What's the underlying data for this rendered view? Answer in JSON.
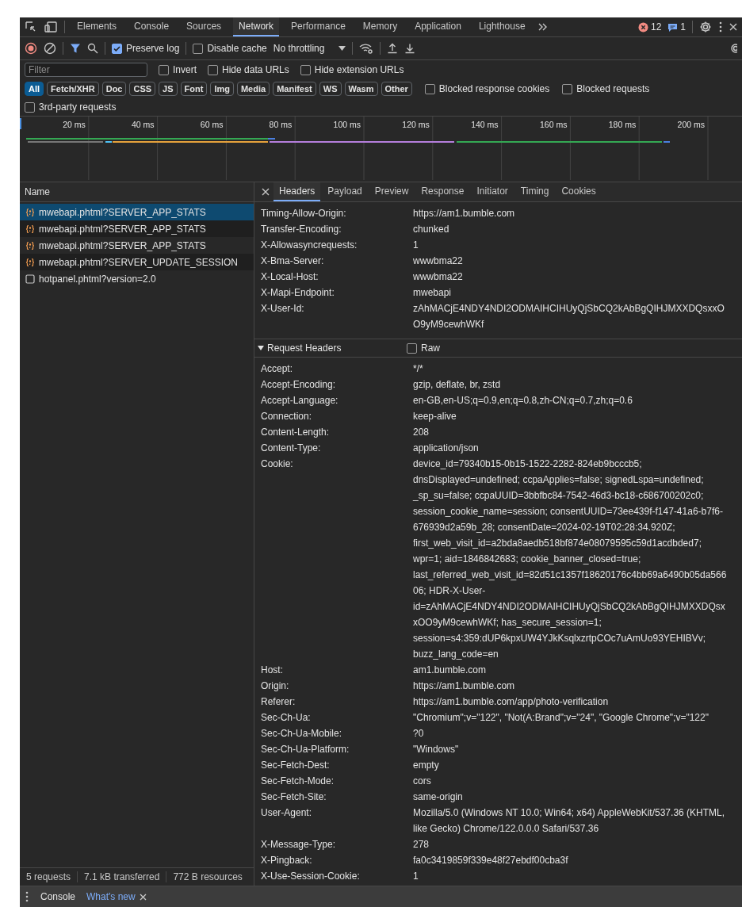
{
  "tabs": [
    {
      "label": "Elements",
      "selected": false
    },
    {
      "label": "Console",
      "selected": false
    },
    {
      "label": "Sources",
      "selected": false
    },
    {
      "label": "Network",
      "selected": true
    },
    {
      "label": "Performance",
      "selected": false
    },
    {
      "label": "Memory",
      "selected": false
    },
    {
      "label": "Application",
      "selected": false
    },
    {
      "label": "Lighthouse",
      "selected": false
    }
  ],
  "issues": {
    "errors": "12",
    "messages": "1"
  },
  "toolbar": {
    "preserve_log": {
      "label": "Preserve log",
      "checked": true
    },
    "disable_cache": {
      "label": "Disable cache",
      "checked": false
    },
    "throttling": "No throttling"
  },
  "filter": {
    "placeholder": "Filter",
    "options": [
      {
        "label": "Invert",
        "checked": false
      },
      {
        "label": "Hide data URLs",
        "checked": false
      },
      {
        "label": "Hide extension URLs",
        "checked": false
      }
    ]
  },
  "type_filters": [
    {
      "label": "All",
      "selected": true
    },
    {
      "label": "Fetch/XHR",
      "selected": false
    },
    {
      "label": "Doc",
      "selected": false
    },
    {
      "label": "CSS",
      "selected": false
    },
    {
      "label": "JS",
      "selected": false
    },
    {
      "label": "Font",
      "selected": false
    },
    {
      "label": "Img",
      "selected": false
    },
    {
      "label": "Media",
      "selected": false
    },
    {
      "label": "Manifest",
      "selected": false
    },
    {
      "label": "WS",
      "selected": false
    },
    {
      "label": "Wasm",
      "selected": false
    },
    {
      "label": "Other",
      "selected": false
    }
  ],
  "extra_filters": [
    {
      "label": "Blocked response cookies",
      "checked": false
    },
    {
      "label": "Blocked requests",
      "checked": false
    }
  ],
  "third_party": {
    "label": "3rd-party requests",
    "checked": false
  },
  "timeline": {
    "ticks": [
      "20 ms",
      "40 ms",
      "60 ms",
      "80 ms",
      "100 ms",
      "120 ms",
      "140 ms",
      "160 ms",
      "180 ms",
      "200 ms"
    ]
  },
  "requests": {
    "column": "Name",
    "rows": [
      {
        "name": "mwebapi.phtml?SERVER_APP_STATS",
        "kind": "xhr",
        "selected": true
      },
      {
        "name": "mwebapi.phtml?SERVER_APP_STATS",
        "kind": "xhr",
        "selected": false
      },
      {
        "name": "mwebapi.phtml?SERVER_APP_STATS",
        "kind": "xhr",
        "selected": false
      },
      {
        "name": "mwebapi.phtml?SERVER_UPDATE_SESSION",
        "kind": "xhr",
        "selected": false
      },
      {
        "name": "hotpanel.phtml?version=2.0",
        "kind": "doc",
        "selected": false
      }
    ]
  },
  "summary": [
    "5 requests",
    "7.1 kB transferred",
    "772 B resources"
  ],
  "detail_tabs": [
    {
      "label": "Headers",
      "selected": true
    },
    {
      "label": "Payload",
      "selected": false
    },
    {
      "label": "Preview",
      "selected": false
    },
    {
      "label": "Response",
      "selected": false
    },
    {
      "label": "Initiator",
      "selected": false
    },
    {
      "label": "Timing",
      "selected": false
    },
    {
      "label": "Cookies",
      "selected": false
    }
  ],
  "response_headers": [
    {
      "name": "Timing-Allow-Origin:",
      "value": "https://am1.bumble.com"
    },
    {
      "name": "Transfer-Encoding:",
      "value": "chunked"
    },
    {
      "name": "X-Allowasyncrequests:",
      "value": "1"
    },
    {
      "name": "X-Bma-Server:",
      "value": "wwwbma22"
    },
    {
      "name": "X-Local-Host:",
      "value": "wwwbma22"
    },
    {
      "name": "X-Mapi-Endpoint:",
      "value": "mwebapi"
    },
    {
      "name": "X-User-Id:",
      "value": "zAhMACjE4NDY4NDI2ODMAIHCIHUyQjSbCQ2kAbBgQIHJMXXDQsxxOO9yM9cewhWKf"
    }
  ],
  "request_headers": {
    "title": "Request Headers",
    "expanded": true,
    "raw": {
      "label": "Raw",
      "checked": false
    },
    "rows": [
      {
        "name": "Accept:",
        "value": "*/*"
      },
      {
        "name": "Accept-Encoding:",
        "value": "gzip, deflate, br, zstd"
      },
      {
        "name": "Accept-Language:",
        "value": "en-GB,en-US;q=0.9,en;q=0.8,zh-CN;q=0.7,zh;q=0.6"
      },
      {
        "name": "Connection:",
        "value": "keep-alive"
      },
      {
        "name": "Content-Length:",
        "value": "208"
      },
      {
        "name": "Content-Type:",
        "value": "application/json"
      },
      {
        "name": "Cookie:",
        "value": "device_id=79340b15-0b15-1522-2282-824eb9bcccb5; dnsDisplayed=undefined; ccpaApplies=false; signedLspa=undefined; _sp_su=false; ccpaUUID=3bbfbc84-7542-46d3-bc18-c686700202c0; session_cookie_name=session; consentUUID=73ee439f-f147-41a6-b7f6-676939d2a59b_28; consentDate=2024-02-19T02:28:34.920Z; first_web_visit_id=a2bda8aedb518bf874e08079595c59d1acdbded7; wpr=1; aid=1846842683; cookie_banner_closed=true; last_referred_web_visit_id=82d51c1357f18620176c4bb69a6490b05da56606; HDR-X-User-id=zAhMACjE4NDY4NDI2ODMAIHCIHUyQjSbCQ2kAbBgQIHJMXXDQsxxOO9yM9cewhWKf; has_secure_session=1; session=s4:359:dUP6kpxUW4YJkKsqlxzrtpCOc7uAmUo93YEHIBVv; buzz_lang_code=en"
      },
      {
        "name": "Host:",
        "value": "am1.bumble.com"
      },
      {
        "name": "Origin:",
        "value": "https://am1.bumble.com"
      },
      {
        "name": "Referer:",
        "value": "https://am1.bumble.com/app/photo-verification"
      },
      {
        "name": "Sec-Ch-Ua:",
        "value": "\"Chromium\";v=\"122\", \"Not(A:Brand\";v=\"24\", \"Google Chrome\";v=\"122\""
      },
      {
        "name": "Sec-Ch-Ua-Mobile:",
        "value": "?0"
      },
      {
        "name": "Sec-Ch-Ua-Platform:",
        "value": "\"Windows\""
      },
      {
        "name": "Sec-Fetch-Dest:",
        "value": "empty"
      },
      {
        "name": "Sec-Fetch-Mode:",
        "value": "cors"
      },
      {
        "name": "Sec-Fetch-Site:",
        "value": "same-origin"
      },
      {
        "name": "User-Agent:",
        "value": "Mozilla/5.0 (Windows NT 10.0; Win64; x64) AppleWebKit/537.36 (KHTML, like Gecko) Chrome/122.0.0.0 Safari/537.36"
      },
      {
        "name": "X-Message-Type:",
        "value": "278"
      },
      {
        "name": "X-Pingback:",
        "value": "fa0c3419859f339e48f27ebdf00cba3f"
      },
      {
        "name": "X-Use-Session-Cookie:",
        "value": "1"
      }
    ]
  },
  "drawer": {
    "tabs": [
      {
        "label": "Console",
        "selected": false,
        "closable": false
      },
      {
        "label": "What's new",
        "selected": true,
        "closable": true
      }
    ]
  }
}
